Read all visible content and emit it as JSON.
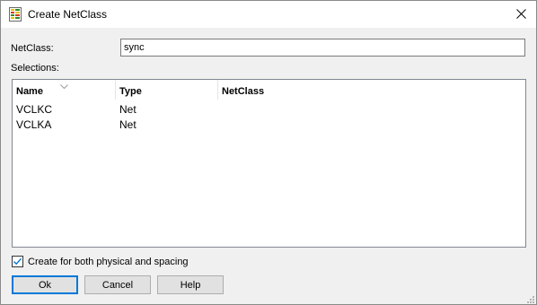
{
  "window": {
    "title": "Create NetClass",
    "icon": "netclass-app-icon",
    "close_icon": "close-icon"
  },
  "form": {
    "netclass_label": "NetClass:",
    "netclass_value": "sync",
    "selections_label": "Selections:"
  },
  "list": {
    "columns": [
      "Name",
      "Type",
      "NetClass"
    ],
    "sort_column": "Name",
    "rows": [
      {
        "name": "VCLKC",
        "type": "Net",
        "netclass": ""
      },
      {
        "name": "VCLKA",
        "type": "Net",
        "netclass": ""
      }
    ]
  },
  "option": {
    "label": "Create  for both physical and spacing",
    "checked": true
  },
  "buttons": {
    "ok": "Ok",
    "cancel": "Cancel",
    "help": "Help"
  },
  "colors": {
    "focus_border": "#0078d7",
    "checkbox_tick": "#0078d7"
  }
}
